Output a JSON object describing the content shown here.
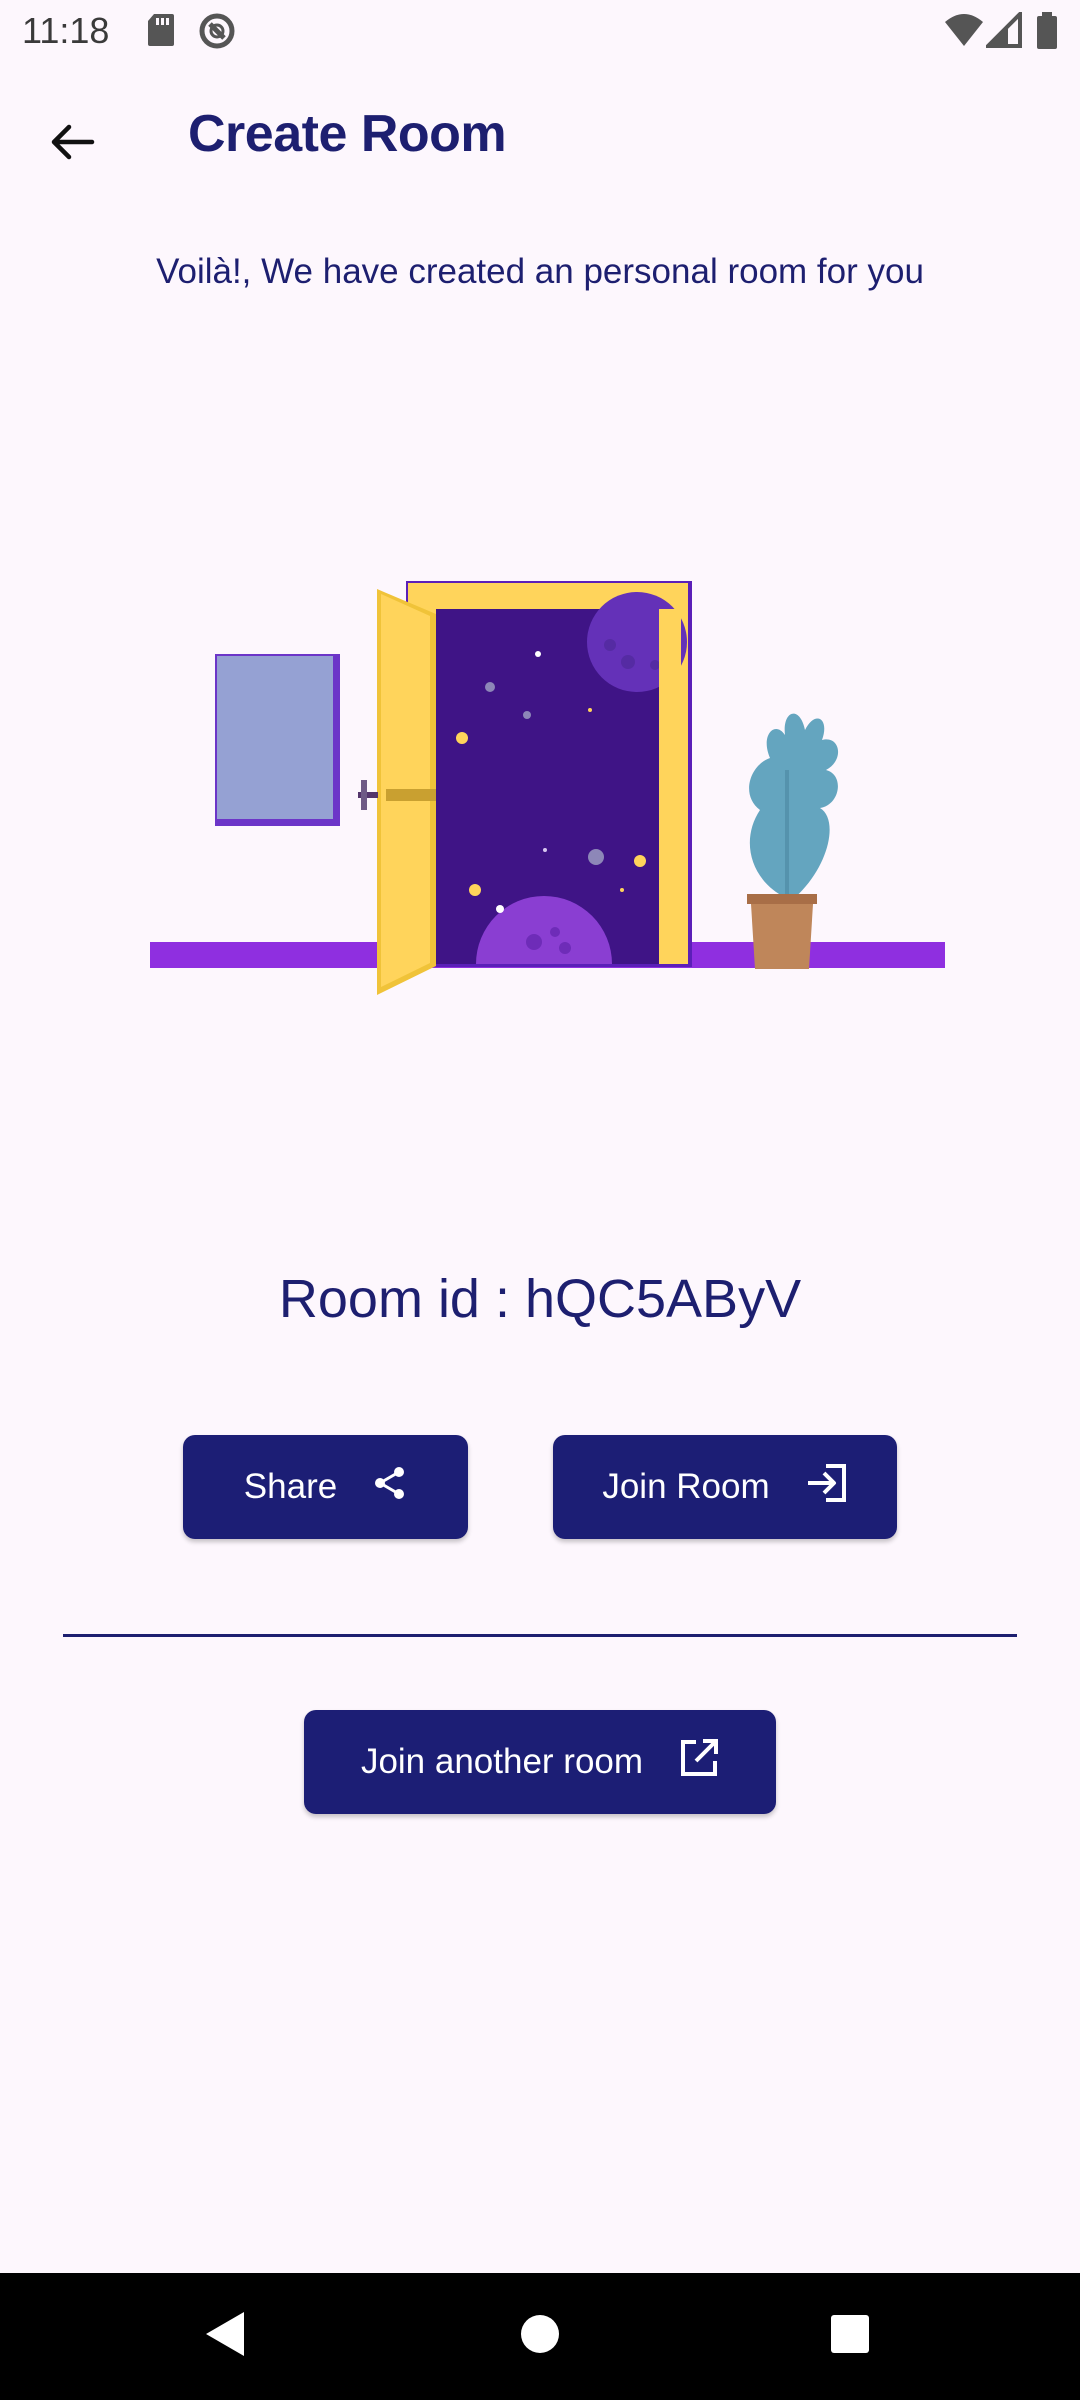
{
  "status_bar": {
    "time": "11:18",
    "icons_left": [
      "sd-card-icon",
      "no-disturb-icon"
    ],
    "icons_right": [
      "wifi-icon",
      "signal-icon",
      "battery-icon"
    ]
  },
  "app_bar": {
    "title": "Create Room",
    "back_icon": "arrow-back-icon"
  },
  "main": {
    "subtitle": "Voilà!, We have created an personal room for you",
    "illustration": "open-door-space-illustration",
    "room_id_text": "Room id : hQC5AByV",
    "share_button": {
      "label": "Share",
      "icon": "share-icon"
    },
    "join_button": {
      "label": "Join Room",
      "icon": "login-icon"
    },
    "join_another_button": {
      "label": "Join another room",
      "icon": "open-in-new-icon"
    }
  },
  "colors": {
    "primary": "#1c1e75",
    "background": "#fdf7fd",
    "text": "#1d1f70"
  },
  "nav_bar": {
    "icons": [
      "back-triangle-icon",
      "home-circle-icon",
      "recents-square-icon"
    ]
  }
}
